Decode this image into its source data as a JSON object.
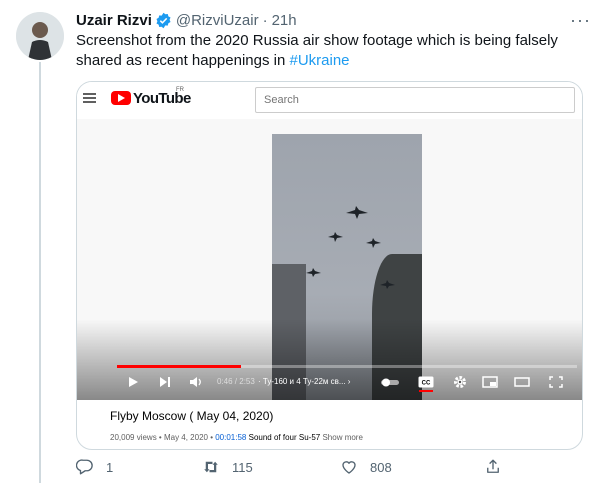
{
  "tweet": {
    "author_name": "Uzair Rizvi",
    "handle": "@RizviUzair",
    "separator": "·",
    "time": "21h",
    "more": "···",
    "text": "Screenshot from the 2020 Russia air show footage which is being falsely shared as recent happenings in ",
    "hashtag": "#Ukraine"
  },
  "youtube": {
    "logo_text": "YouTube",
    "region": "FR",
    "search_placeholder": "Search",
    "player": {
      "time": "0:46 / 2:53",
      "chapter": "· Ту-160 и 4 Ту-22м св...",
      "chapter_arrow": "›",
      "progress_fraction": 0.27
    },
    "video_title": "Flyby Moscow ( May 04, 2020)",
    "views": "20,009 views",
    "date": "May 4, 2020",
    "timestamp": "00:01:58",
    "description": "Sound of four Su-57",
    "show_more": "Show more"
  },
  "actions": {
    "replies": "1",
    "retweets": "115",
    "likes": "808"
  },
  "colors": {
    "link_blue": "#1d9bf0",
    "youtube_red": "#ff0000",
    "muted": "#536471"
  }
}
